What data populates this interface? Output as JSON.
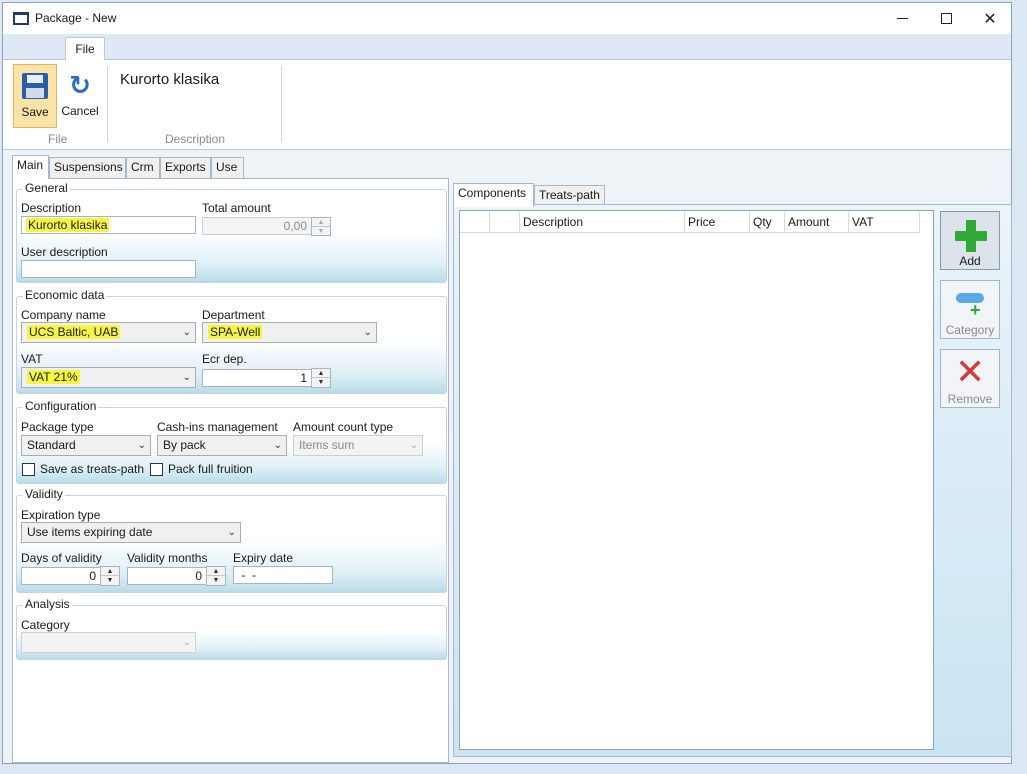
{
  "window": {
    "title": "Package - New"
  },
  "ribbon": {
    "tab_file": "File",
    "save_label": "Save",
    "cancel_label": "Cancel",
    "group_file": "File",
    "group_description": "Description",
    "description_value": "Kurorto klasika"
  },
  "tabs": [
    "Main",
    "Suspensions",
    "Crm",
    "Exports",
    "Use"
  ],
  "general": {
    "title": "General",
    "description_label": "Description",
    "description_value": "Kurorto klasika",
    "total_amount_label": "Total amount",
    "total_amount_value": "0,00",
    "user_description_label": "User description",
    "user_description_value": ""
  },
  "economic": {
    "title": "Economic data",
    "company_label": "Company name",
    "company_value": "UCS Baltic, UAB",
    "department_label": "Department",
    "department_value": "SPA-Well",
    "vat_label": "VAT",
    "vat_value": "VAT 21%",
    "ecr_label": "Ecr dep.",
    "ecr_value": "1"
  },
  "configuration": {
    "title": "Configuration",
    "package_type_label": "Package type",
    "package_type_value": "Standard",
    "cashins_label": "Cash-ins management",
    "cashins_value": "By pack",
    "amount_count_label": "Amount count type",
    "amount_count_value": "Items sum",
    "save_treats_label": "Save as treats-path",
    "pack_full_label": "Pack full fruition"
  },
  "validity": {
    "title": "Validity",
    "expiration_label": "Expiration type",
    "expiration_value": "Use items expiring date",
    "days_label": "Days of validity",
    "days_value": "0",
    "months_label": "Validity months",
    "months_value": "0",
    "expiry_label": "Expiry date",
    "expiry_value": " -  -"
  },
  "analysis": {
    "title": "Analysis",
    "category_label": "Category",
    "category_value": ""
  },
  "right_tabs": [
    "Components",
    "Treats-path"
  ],
  "grid": {
    "columns": [
      "",
      "",
      "Description",
      "Price",
      "Qty",
      "Amount",
      "VAT"
    ]
  },
  "actions": {
    "add_label": "Add",
    "category_label": "Category",
    "remove_label": "Remove"
  },
  "highlight_color": "#f5f542",
  "accent_color": "#2fa836"
}
